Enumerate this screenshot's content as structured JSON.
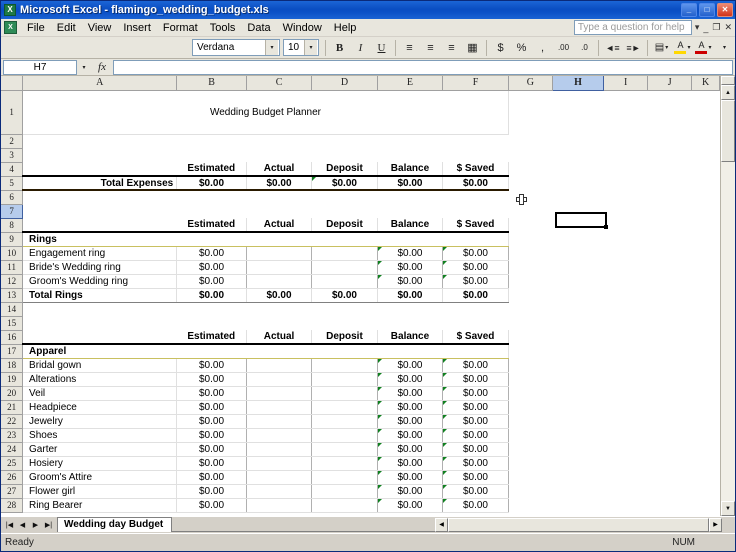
{
  "window": {
    "title": "Microsoft Excel - flamingo_wedding_budget.xls",
    "app_icon": "excel-icon",
    "minimize": "_",
    "maximize": "□",
    "close": "✕",
    "doc_minimize": "_",
    "doc_restore": "❐",
    "doc_close": "✕"
  },
  "menu": {
    "items": [
      "File",
      "Edit",
      "View",
      "Insert",
      "Format",
      "Tools",
      "Data",
      "Window",
      "Help"
    ],
    "ask_placeholder": "Type a question for help"
  },
  "toolbar": {
    "font_name": "Verdana",
    "font_size": "10",
    "bold": "B",
    "italic": "I",
    "underline": "U",
    "align_left": "≡",
    "align_center": "≡",
    "align_right": "≡",
    "merge_center": "▦",
    "currency": "$",
    "percent": "%",
    "comma": ",",
    "increase_decimal": ".00",
    "decrease_decimal": ".0",
    "decrease_indent": "◄≡",
    "increase_indent": "≡►",
    "borders": "▤",
    "fill_color": "A",
    "font_color": "A",
    "dropdown": "▾"
  },
  "formula_bar": {
    "name_box": "H7",
    "fx": "fx",
    "value": ""
  },
  "grid": {
    "columns": [
      "A",
      "B",
      "C",
      "D",
      "E",
      "F",
      "G",
      "H",
      "I",
      "J",
      "K"
    ],
    "selected_column": "H",
    "selected_row": 7,
    "selected_cell": "H7",
    "title_banner": "Wedding Budget Planner",
    "col_headers": [
      "Estimated",
      "Actual",
      "Deposit",
      "Balance",
      "$ Saved"
    ],
    "zero": "$0.00",
    "rows": [
      {
        "n": 1,
        "type": "banner"
      },
      {
        "n": 2,
        "type": "empty"
      },
      {
        "n": 3,
        "type": "empty"
      },
      {
        "n": 4,
        "type": "colheaders"
      },
      {
        "n": 5,
        "type": "total",
        "label": "Total Expenses",
        "values": [
          "$0.00",
          "$0.00",
          "$0.00",
          "$0.00",
          "$0.00"
        ]
      },
      {
        "n": 6,
        "type": "empty"
      },
      {
        "n": 7,
        "type": "empty"
      },
      {
        "n": 8,
        "type": "colheaders"
      },
      {
        "n": 9,
        "type": "section",
        "label": "Rings"
      },
      {
        "n": 10,
        "type": "item",
        "label": "Engagement ring",
        "values": [
          "$0.00",
          "",
          "",
          "$0.00",
          "$0.00"
        ]
      },
      {
        "n": 11,
        "type": "item",
        "label": "Bride's Wedding ring",
        "values": [
          "$0.00",
          "",
          "",
          "$0.00",
          "$0.00"
        ]
      },
      {
        "n": 12,
        "type": "item",
        "label": "Groom's Wedding ring",
        "values": [
          "$0.00",
          "",
          "",
          "$0.00",
          "$0.00"
        ]
      },
      {
        "n": 13,
        "type": "subtotal",
        "label": "Total Rings",
        "values": [
          "$0.00",
          "$0.00",
          "$0.00",
          "$0.00",
          "$0.00"
        ]
      },
      {
        "n": 14,
        "type": "empty"
      },
      {
        "n": 15,
        "type": "empty"
      },
      {
        "n": 16,
        "type": "colheaders"
      },
      {
        "n": 17,
        "type": "section",
        "label": "Apparel"
      },
      {
        "n": 18,
        "type": "item",
        "label": "Bridal gown",
        "values": [
          "$0.00",
          "",
          "",
          "$0.00",
          "$0.00"
        ]
      },
      {
        "n": 19,
        "type": "item",
        "label": "Alterations",
        "values": [
          "$0.00",
          "",
          "",
          "$0.00",
          "$0.00"
        ]
      },
      {
        "n": 20,
        "type": "item",
        "label": "Veil",
        "values": [
          "$0.00",
          "",
          "",
          "$0.00",
          "$0.00"
        ]
      },
      {
        "n": 21,
        "type": "item",
        "label": "Headpiece",
        "values": [
          "$0.00",
          "",
          "",
          "$0.00",
          "$0.00"
        ]
      },
      {
        "n": 22,
        "type": "item",
        "label": "Jewelry",
        "values": [
          "$0.00",
          "",
          "",
          "$0.00",
          "$0.00"
        ]
      },
      {
        "n": 23,
        "type": "item",
        "label": "Shoes",
        "values": [
          "$0.00",
          "",
          "",
          "$0.00",
          "$0.00"
        ]
      },
      {
        "n": 24,
        "type": "item",
        "label": "Garter",
        "values": [
          "$0.00",
          "",
          "",
          "$0.00",
          "$0.00"
        ]
      },
      {
        "n": 25,
        "type": "item",
        "label": "Hosiery",
        "values": [
          "$0.00",
          "",
          "",
          "$0.00",
          "$0.00"
        ]
      },
      {
        "n": 26,
        "type": "item",
        "label": "Groom's Attire",
        "values": [
          "$0.00",
          "",
          "",
          "$0.00",
          "$0.00"
        ]
      },
      {
        "n": 27,
        "type": "item",
        "label": "Flower girl",
        "values": [
          "$0.00",
          "",
          "",
          "$0.00",
          "$0.00"
        ]
      },
      {
        "n": 28,
        "type": "item",
        "label": "Ring Bearer",
        "values": [
          "$0.00",
          "",
          "",
          "$0.00",
          "$0.00"
        ]
      }
    ]
  },
  "colors": {
    "banner_pink": "#CC7A91",
    "total_peach": "#FBCE97",
    "section_yellow": "#FFFF99",
    "selection_blue": "#B6CCEC"
  },
  "sheet_tabs": {
    "first": "|◀",
    "prev": "◀",
    "next": "▶",
    "last": "▶|",
    "active": "Wedding day Budget"
  },
  "status_bar": {
    "mode": "Ready",
    "num_lock": "NUM"
  }
}
